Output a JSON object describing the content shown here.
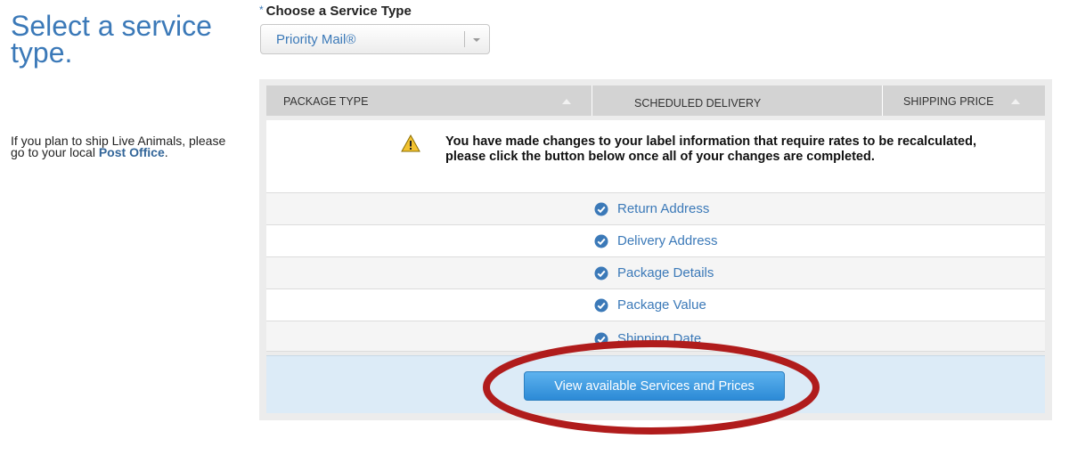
{
  "left": {
    "title": "Select a service type.",
    "note_prefix": "If you plan to ship Live Animals, please go to your local ",
    "note_link": "Post Office",
    "note_suffix": "."
  },
  "service": {
    "required_mark": "*",
    "label": "Choose a Service Type",
    "selected": "Priority Mail®"
  },
  "table": {
    "headers": [
      "PACKAGE TYPE",
      "SCHEDULED DELIVERY",
      "SHIPPING PRICE"
    ]
  },
  "warning": {
    "message": "You have made changes to your label information that require rates to be recalculated, please click the button below once all of your changes are completed."
  },
  "checklist": [
    "Return Address",
    "Delivery Address",
    "Package Details",
    "Package Value",
    "Shipping Date"
  ],
  "action": {
    "button_label": "View available Services and Prices"
  },
  "colors": {
    "accent": "#3b79b8",
    "button": "#2c8ad6",
    "highlight": "#b01c1c",
    "warning": "#f2c230"
  },
  "icons": {
    "check": "check-circle-icon",
    "warning": "warning-triangle-icon",
    "caret": "chevron-down-icon",
    "sort": "sort-up-icon"
  }
}
